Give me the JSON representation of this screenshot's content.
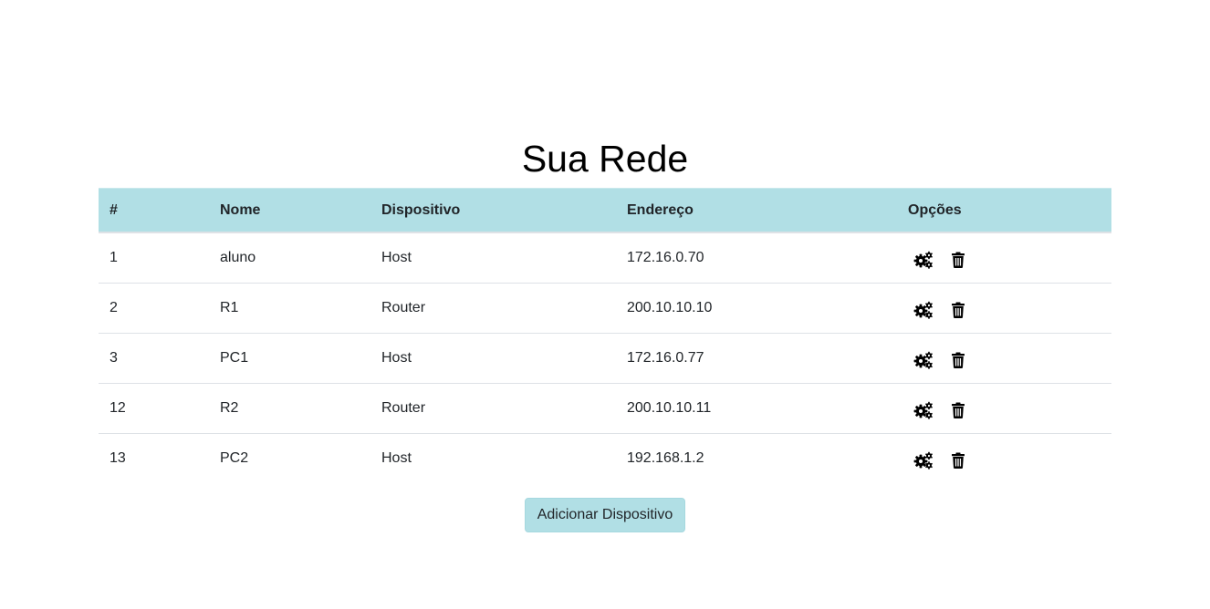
{
  "page": {
    "title": "Sua Rede"
  },
  "table": {
    "headers": {
      "id": "#",
      "name": "Nome",
      "device": "Dispositivo",
      "address": "Endereço",
      "options": "Opções"
    },
    "rows": [
      {
        "id": "1",
        "name": "aluno",
        "device": "Host",
        "address": "172.16.0.70"
      },
      {
        "id": "2",
        "name": "R1",
        "device": "Router",
        "address": "200.10.10.10"
      },
      {
        "id": "3",
        "name": "PC1",
        "device": "Host",
        "address": "172.16.0.77"
      },
      {
        "id": "12",
        "name": "R2",
        "device": "Router",
        "address": "200.10.10.11"
      },
      {
        "id": "13",
        "name": "PC2",
        "device": "Host",
        "address": "192.168.1.2"
      }
    ],
    "row_actions": {
      "configure_icon": "cogs-icon",
      "delete_icon": "trash-icon"
    }
  },
  "actions": {
    "add_label": "Adicionar Dispositivo"
  },
  "colors": {
    "accent": "#b1dfe5",
    "text": "#212529",
    "divider": "#dee2e6"
  }
}
